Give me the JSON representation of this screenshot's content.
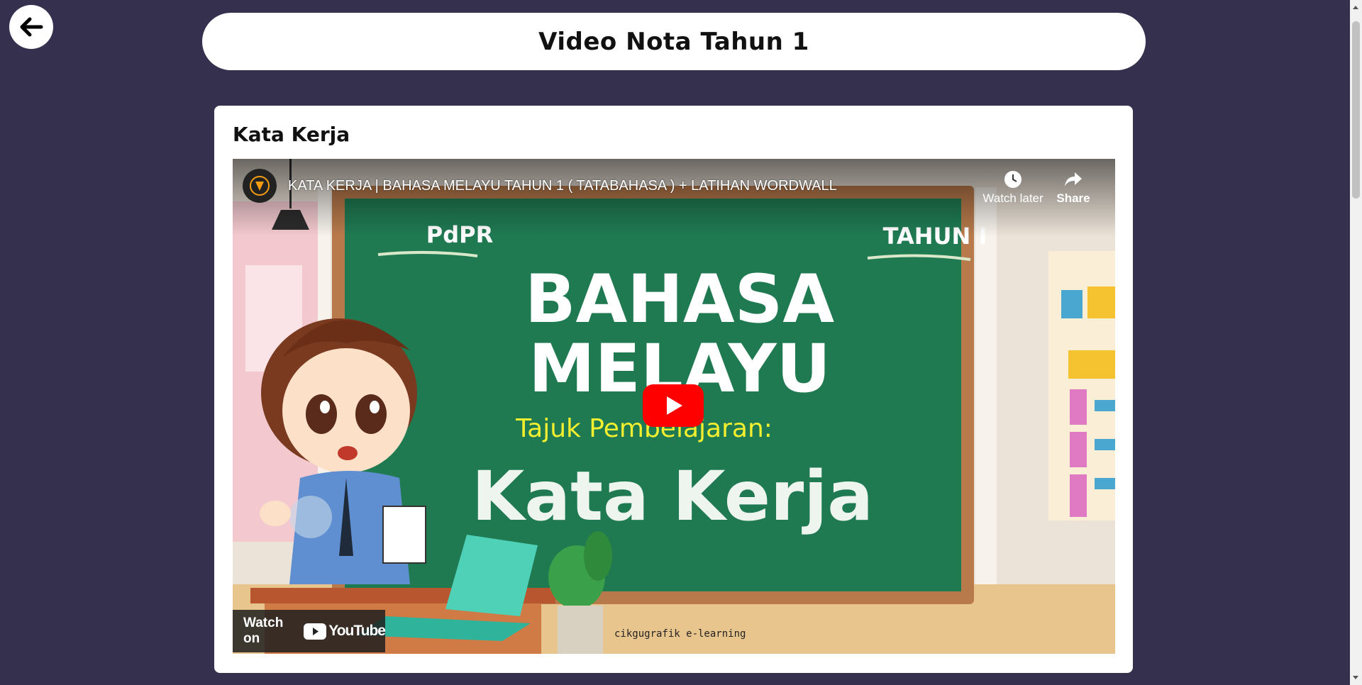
{
  "header": {
    "title": "Video Nota Tahun 1"
  },
  "card": {
    "title": "Kata Kerja"
  },
  "video": {
    "title": "KATA KERJA | BAHASA MELAYU TAHUN 1 ( TATABAHASA ) + LATIHAN WORDWALL",
    "watch_later_label": "Watch later",
    "share_label": "Share",
    "watch_on_label": "Watch on",
    "youtube_label": "YouTube",
    "thumbnail": {
      "pdpr": "PdPR",
      "tahun": "TAHUN I",
      "subject_line1": "BAHASA",
      "subject_line2": "MELAYU",
      "topic_label": "Tajuk Pembelajaran:",
      "topic": "Kata Kerja",
      "credit": "cikgugrafik e-learning"
    }
  },
  "colors": {
    "page_background": "#34304e",
    "board_green": "#1f7a52",
    "youtube_red": "#ff0000",
    "topic_yellow": "#f4ef2f"
  }
}
